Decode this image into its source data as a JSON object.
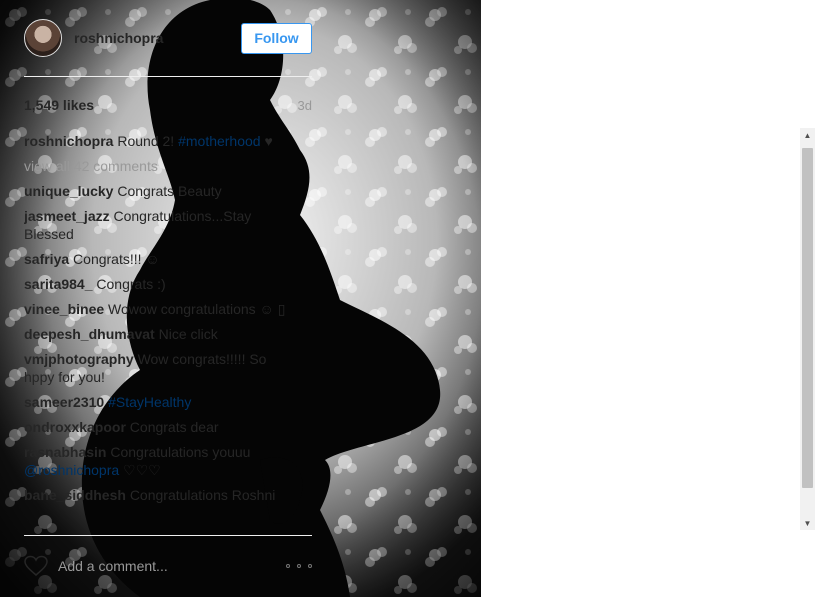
{
  "post": {
    "username": "roshnichopra",
    "follow_label": "Follow",
    "likes": "1,549 likes",
    "age": "3d",
    "caption": {
      "user": "roshnichopra",
      "text": "Round 2!",
      "hashtag": "#motherhood",
      "emoji": "♥"
    },
    "view_all": "view all 42 comments",
    "comments": [
      {
        "user": "unique_lucky",
        "text": "Congrats Beauty"
      },
      {
        "user": "jasmeet_jazz",
        "text": "Congratulations...Stay Blessed"
      },
      {
        "user": "safriya",
        "text": "Congrats!!! ☺"
      },
      {
        "user": "sarita984_",
        "text": "Congrats :)"
      },
      {
        "user": "vinee_binee",
        "text": "Wowow congratulations ☺ ▯"
      },
      {
        "user": "deepesh_dhumavat",
        "text": "Nice click"
      },
      {
        "user": "vmjphotography",
        "text": "Wow congrats!!!!! So hppy for you!"
      },
      {
        "user": "sameer2310",
        "text": "",
        "tag": "#StayHealthy"
      },
      {
        "user": "ondroxxkapoor",
        "text": "Congrats dear"
      },
      {
        "user": "rasnabhasin",
        "text": "Congratulations youuu",
        "tag": "@roshnichopra",
        "after": "♡♡♡"
      },
      {
        "user": "bane_siddhesh",
        "text": "Congratulations Roshni"
      }
    ],
    "add_comment_placeholder": "Add a comment..."
  },
  "icons": {
    "like": "heart-icon",
    "more": "more-options-icon",
    "scroll_up": "scroll-up-arrow-icon",
    "scroll_down": "scroll-down-arrow-icon"
  },
  "colors": {
    "accent": "#3897f0",
    "hashtag": "#003569",
    "muted": "#999999"
  }
}
